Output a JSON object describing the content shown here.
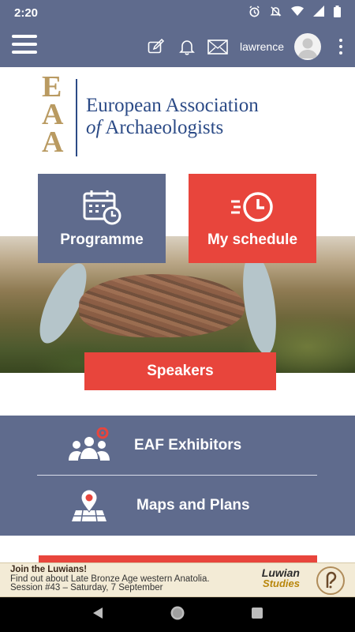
{
  "status_bar": {
    "time": "2:20",
    "icons": [
      "alarm-icon",
      "notifications-off-icon",
      "wifi-icon",
      "signal-icon",
      "battery-icon"
    ]
  },
  "header": {
    "username": "lawrence",
    "icons": [
      "menu-icon",
      "edit-icon",
      "bell-icon",
      "mail-icon",
      "avatar",
      "more-vert-icon"
    ]
  },
  "logo": {
    "letters": [
      "E",
      "A",
      "A"
    ],
    "line1": "European Association",
    "line2_prefix": "of",
    "line2_rest": " Archaeologists"
  },
  "tiles": {
    "programme": "Programme",
    "schedule": "My schedule",
    "speakers": "Speakers"
  },
  "panel": {
    "exhibitors": "EAF Exhibitors",
    "maps": "Maps and Plans"
  },
  "banner": {
    "title": "Join the Luwians!",
    "line2": "Find out about Late Bronze Age western Anatolia.",
    "line3": "Session #43 – Saturday, 7 September",
    "brand1": "Luwian",
    "brand2": "Studies"
  },
  "colors": {
    "primary": "#5f6b8d",
    "accent": "#e8453c",
    "logo_blue": "#2b4a86",
    "logo_gold": "#b99a61"
  }
}
